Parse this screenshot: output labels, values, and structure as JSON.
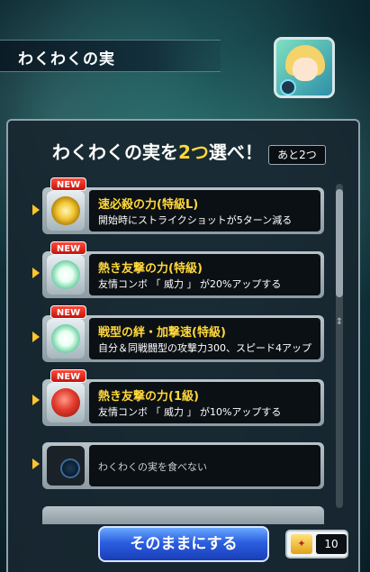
{
  "header": {
    "title": "わくわくの実"
  },
  "panel": {
    "heading_pre": "わくわくの実を",
    "heading_accent": "2つ",
    "heading_post": "選べ！",
    "remaining": "あと2つ"
  },
  "items": [
    {
      "badge": "NEW",
      "name": "速必殺の力(特級L)",
      "desc": "開始時にストライクショットが5ターン減る",
      "icon": "gold-sphere-icon"
    },
    {
      "badge": "NEW",
      "name": "熱き友撃の力(特級)",
      "desc": "友情コンボ 「 威力 」 が20%アップする",
      "icon": "lotus-fruit-icon"
    },
    {
      "badge": "NEW",
      "name": "戦型の絆・加撃速(特級)",
      "desc": "自分＆同戦闘型の攻撃力300、スピード4アップ",
      "icon": "lotus-fruit-icon"
    },
    {
      "badge": "NEW",
      "name": "熱き友撃の力(1級)",
      "desc": "友情コンボ 「 威力 」 が10%アップする",
      "icon": "red-fruit-icon"
    }
  ],
  "skip_item": {
    "label": "わくわくの実を食べない"
  },
  "footer": {
    "confirm_label": "そのままにする",
    "ticket_count": "10"
  },
  "colors": {
    "accent": "#ffd83a",
    "button": "#2b5fe0",
    "badge": "#e23a2a"
  }
}
